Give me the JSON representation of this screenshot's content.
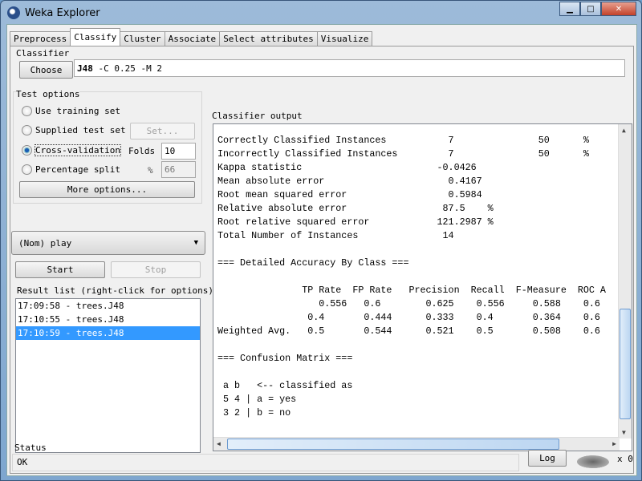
{
  "window": {
    "title": "Weka Explorer",
    "minimize": "▁",
    "maximize": "□",
    "close": "✕"
  },
  "tabs": [
    "Preprocess",
    "Classify",
    "Cluster",
    "Associate",
    "Select attributes",
    "Visualize"
  ],
  "classifier": {
    "group_label": "Classifier",
    "choose_label": "Choose",
    "name": "J48",
    "options": " -C 0.25 -M 2"
  },
  "test_options": {
    "group_label": "Test options",
    "use_training": "Use training set",
    "supplied": "Supplied test set",
    "set_label": "Set...",
    "cross_validation": "Cross-validation",
    "folds_label": "Folds",
    "folds_value": "10",
    "percentage": "Percentage split",
    "pct_label": "%",
    "pct_value": "66",
    "more_options": "More options...",
    "selected": "Cross-validation"
  },
  "class_attribute": "(Nom) play",
  "start_label": "Start",
  "stop_label": "Stop",
  "result_list": {
    "label": "Result list (right-click for options)",
    "items": [
      "17:09:58 - trees.J48",
      "17:10:55 - trees.J48",
      "17:10:59 - trees.J48"
    ],
    "selected_index": 2
  },
  "output": {
    "label": "Classifier output",
    "text": "Correctly Classified Instances           7               50      %\nIncorrectly Classified Instances         7               50      %\nKappa statistic                        -0.0426\nMean absolute error                      0.4167\nRoot mean squared error                  0.5984\nRelative absolute error                 87.5    %\nRoot relative squared error            121.2987 %\nTotal Number of Instances               14\n\n=== Detailed Accuracy By Class ===\n\n               TP Rate  FP Rate   Precision  Recall  F-Measure  ROC A\n                  0.556   0.6        0.625    0.556     0.588    0.6\n                0.4       0.444      0.333    0.4       0.364    0.6\nWeighted Avg.   0.5       0.544      0.521    0.5       0.508    0.6\n\n=== Confusion Matrix ===\n\n a b   <-- classified as\n 5 4 | a = yes\n 3 2 | b = no"
  },
  "status": {
    "label": "Status",
    "text": "OK",
    "log_label": "Log",
    "count": "x 0"
  },
  "colors": {
    "selection": "#3399ff",
    "frame": "#7ea6cf"
  }
}
